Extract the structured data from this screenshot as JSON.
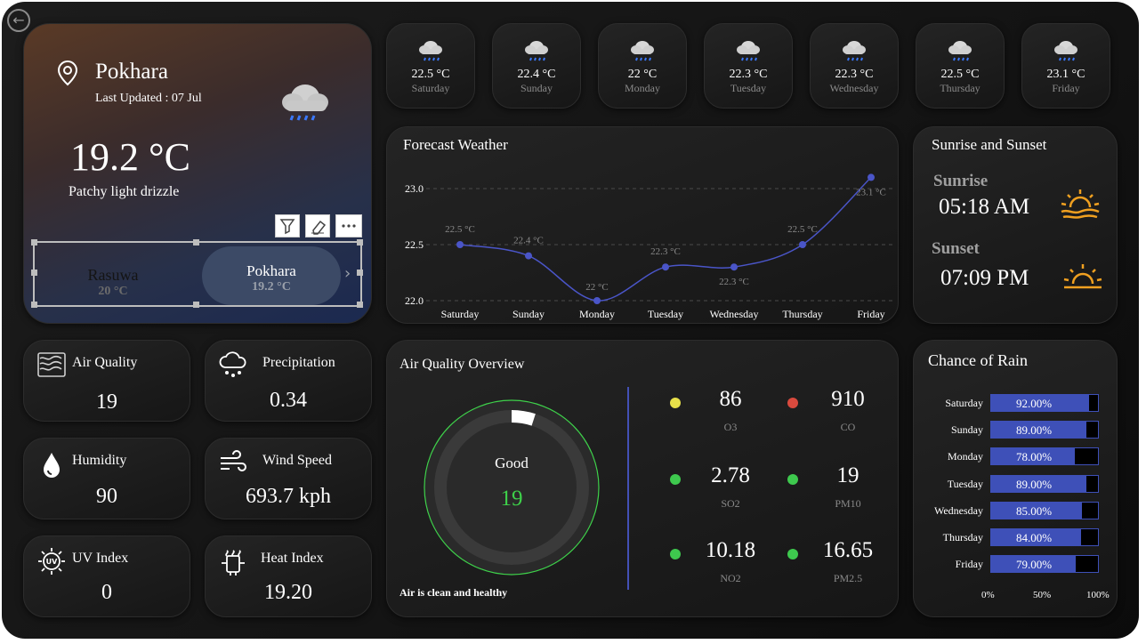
{
  "location": {
    "city": "Pokhara",
    "last_updated": "Last Updated : 07 Jul",
    "temperature": "19.2 °C",
    "condition": "Patchy light drizzle"
  },
  "slicer": {
    "items": [
      {
        "name": "Rasuwa",
        "temp": "20 °C"
      },
      {
        "name": "Pokhara",
        "temp": "19.2 °C"
      }
    ]
  },
  "daily": [
    {
      "temp": "22.5 °C",
      "day": "Saturday"
    },
    {
      "temp": "22.4 °C",
      "day": "Sunday"
    },
    {
      "temp": "22 °C",
      "day": "Monday"
    },
    {
      "temp": "22.3 °C",
      "day": "Tuesday"
    },
    {
      "temp": "22.3 °C",
      "day": "Wednesday"
    },
    {
      "temp": "22.5 °C",
      "day": "Thursday"
    },
    {
      "temp": "23.1 °C",
      "day": "Friday"
    }
  ],
  "forecast_title": "Forecast Weather",
  "sun": {
    "title": "Sunrise and Sunset",
    "sunrise_label": "Sunrise",
    "sunrise": "05:18 AM",
    "sunset_label": "Sunset",
    "sunset": "07:09 PM"
  },
  "metrics": {
    "air_quality": {
      "label": "Air Quality",
      "value": "19"
    },
    "precipitation": {
      "label": "Precipitation",
      "value": "0.34"
    },
    "humidity": {
      "label": "Humidity",
      "value": "90"
    },
    "wind": {
      "label": "Wind Speed",
      "value": "693.7 kph"
    },
    "uv": {
      "label": "UV Index",
      "value": "0"
    },
    "heat": {
      "label": "Heat Index",
      "value": "19.20"
    }
  },
  "aq_overview": {
    "title": "Air Quality Overview",
    "gauge_label": "Good",
    "gauge_value": "19",
    "gauge_fraction": 0.05,
    "footer": "Air is clean and healthy",
    "pollutants": [
      {
        "value": "86",
        "name": "O3",
        "color": "#e8e14a"
      },
      {
        "value": "910",
        "name": "CO",
        "color": "#d94a3e"
      },
      {
        "value": "2.78",
        "name": "SO2",
        "color": "#3ec94e"
      },
      {
        "value": "19",
        "name": "PM10",
        "color": "#3ec94e"
      },
      {
        "value": "10.18",
        "name": "NO2",
        "color": "#3ec94e"
      },
      {
        "value": "16.65",
        "name": "PM2.5",
        "color": "#3ec94e"
      }
    ]
  },
  "rain": {
    "title": "Chance of Rain",
    "axis": [
      "0%",
      "50%",
      "100%"
    ]
  },
  "chart_data": [
    {
      "type": "line",
      "title": "Forecast Weather",
      "categories": [
        "Saturday",
        "Sunday",
        "Monday",
        "Tuesday",
        "Wednesday",
        "Thursday",
        "Friday"
      ],
      "values": [
        22.5,
        22.4,
        22.0,
        22.3,
        22.3,
        22.5,
        23.1
      ],
      "data_labels": [
        "22.5 °C",
        "22.4 °C",
        "22 °C",
        "22.3 °C",
        "22.3 °C",
        "22.5 °C",
        "23.1 °C"
      ],
      "yticks": [
        "22.0",
        "22.5",
        "23.0"
      ],
      "ylim": [
        22.0,
        23.0
      ],
      "color": "#4a55c8"
    },
    {
      "type": "bar",
      "title": "Chance of Rain",
      "categories": [
        "Saturday",
        "Sunday",
        "Monday",
        "Tuesday",
        "Wednesday",
        "Thursday",
        "Friday"
      ],
      "values": [
        92,
        89,
        78,
        89,
        85,
        84,
        79
      ],
      "data_labels": [
        "92.00%",
        "89.00%",
        "78.00%",
        "89.00%",
        "85.00%",
        "84.00%",
        "79.00%"
      ],
      "xlim": [
        0,
        100
      ],
      "color": "#3e50b8"
    }
  ]
}
